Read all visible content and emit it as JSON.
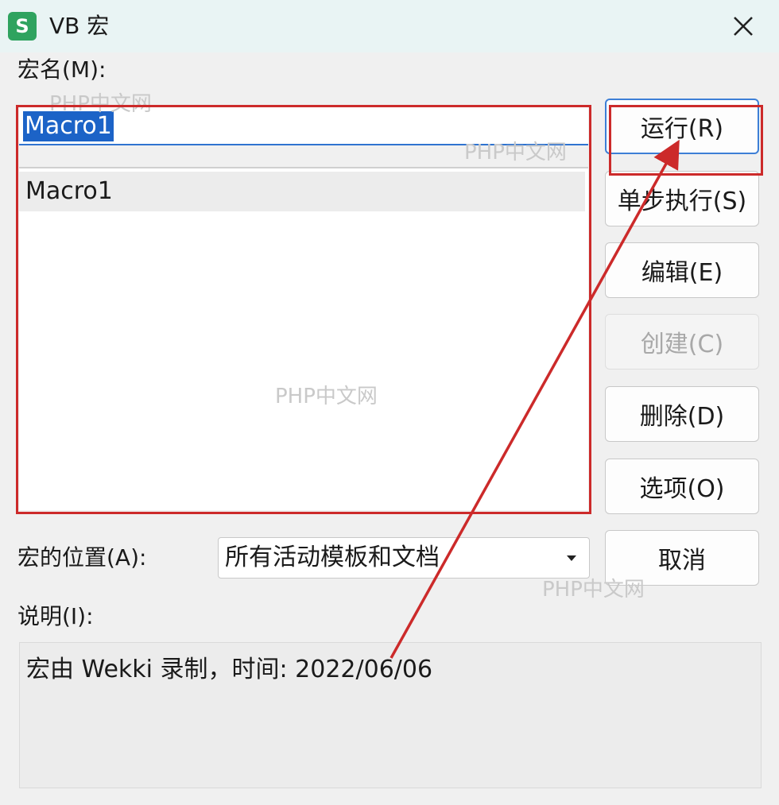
{
  "window": {
    "title": "VB 宏",
    "app_icon_letter": "S",
    "accent": "#2fa35f"
  },
  "macro_name": {
    "label": "宏名(M):",
    "value": "Macro1"
  },
  "macro_list": {
    "items": [
      "Macro1"
    ]
  },
  "buttons": {
    "run": "运行(R)",
    "step": "单步执行(S)",
    "edit": "编辑(E)",
    "create": "创建(C)",
    "delete": "删除(D)",
    "options": "选项(O)",
    "cancel": "取消"
  },
  "location": {
    "label": "宏的位置(A):",
    "selected": "所有活动模板和文档"
  },
  "description": {
    "label": "说明(I):",
    "text": "宏由 Wekki 录制，时间: 2022/06/06"
  },
  "watermark": {
    "text": "PHP中文网"
  },
  "annotation": {
    "color": "#cc2a2a"
  },
  "icons": {
    "close": "close-icon",
    "dropdown": "chevron-down-icon"
  }
}
